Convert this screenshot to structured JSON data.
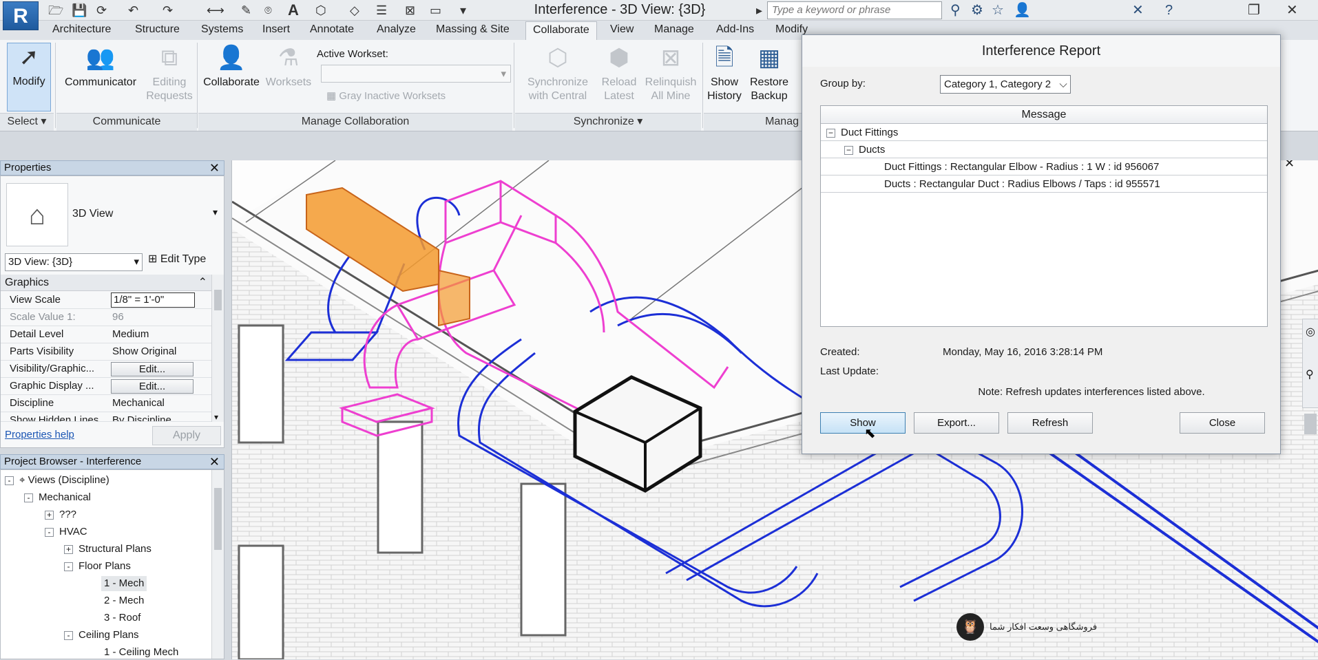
{
  "app": {
    "logo_letter": "R",
    "window_title": "Interference - 3D View: {3D}",
    "search_placeholder": "Type a keyword or phrase"
  },
  "tabs": [
    "Architecture",
    "Structure",
    "Systems",
    "Insert",
    "Annotate",
    "Analyze",
    "Massing & Site",
    "Collaborate",
    "View",
    "Manage",
    "Add-Ins",
    "Modify"
  ],
  "active_tab": "Collaborate",
  "ribbon": {
    "modify": "Modify",
    "select": "Select",
    "communicator": "Communicator",
    "editing_requests_1": "Editing",
    "editing_requests_2": "Requests",
    "communicate": "Communicate",
    "collaborate": "Collaborate",
    "worksets": "Worksets",
    "active_workset": "Active Workset:",
    "gray_inactive": "Gray Inactive Worksets",
    "manage_collaboration": "Manage Collaboration",
    "sync_1": "Synchronize",
    "sync_2": "with Central",
    "reload_1": "Reload",
    "reload_2": "Latest",
    "relinquish_1": "Relinquish",
    "relinquish_2": "All Mine",
    "synchronize": "Synchronize",
    "show_history_1": "Show",
    "show_history_2": "History",
    "restore_backup_1": "Restore",
    "restore_backup_2": "Backup",
    "manage_panel": "Manag"
  },
  "properties": {
    "title": "Properties",
    "type_name": "3D View",
    "view_selector": "3D View: {3D}",
    "edit_type": "Edit Type",
    "section": "Graphics",
    "rows": [
      {
        "key": "View Scale",
        "value": "1/8\" = 1'-0\""
      },
      {
        "key": "Scale Value    1:",
        "value": "96"
      },
      {
        "key": "Detail Level",
        "value": "Medium"
      },
      {
        "key": "Parts Visibility",
        "value": "Show Original"
      },
      {
        "key": "Visibility/Graphic...",
        "value": "Edit..."
      },
      {
        "key": "Graphic Display ...",
        "value": "Edit..."
      },
      {
        "key": "Discipline",
        "value": "Mechanical"
      },
      {
        "key": "Show Hidden Lines",
        "value": "By Discipline"
      }
    ],
    "help": "Properties help",
    "apply": "Apply"
  },
  "browser": {
    "title": "Project Browser - Interference",
    "items": [
      {
        "label": "Views (Discipline)",
        "toggle": "-"
      },
      {
        "label": "Mechanical",
        "toggle": "-"
      },
      {
        "label": "???",
        "toggle": "+"
      },
      {
        "label": "HVAC",
        "toggle": "-"
      },
      {
        "label": "Structural Plans",
        "toggle": "+"
      },
      {
        "label": "Floor Plans",
        "toggle": "-"
      },
      {
        "label": "1 - Mech",
        "toggle": ""
      },
      {
        "label": "2 - Mech",
        "toggle": ""
      },
      {
        "label": "3 - Roof",
        "toggle": ""
      },
      {
        "label": "Ceiling Plans",
        "toggle": "-"
      },
      {
        "label": "1 - Ceiling Mech",
        "toggle": ""
      }
    ]
  },
  "dialog": {
    "title": "Interference Report",
    "group_by_label": "Group by:",
    "group_by_value": "Category 1, Category 2",
    "column": "Message",
    "items": [
      "Duct Fittings",
      "Ducts",
      "Duct Fittings : Rectangular Elbow - Radius : 1 W : id 956067",
      "Ducts : Rectangular Duct : Radius Elbows / Taps : id 955571"
    ],
    "created_label": "Created:",
    "created_value": "Monday, May 16, 2016 3:28:14 PM",
    "last_update_label": "Last Update:",
    "note": "Note: Refresh updates interferences listed above.",
    "buttons": {
      "show": "Show",
      "export": "Export...",
      "refresh": "Refresh",
      "close": "Close"
    }
  },
  "watermark": "فروشگاهی وسعت افکار شما",
  "colors": {
    "duct_blue": "#1c2fd6",
    "duct_pink": "#ee3fd0",
    "highlight_orange": "#f39a2e"
  }
}
